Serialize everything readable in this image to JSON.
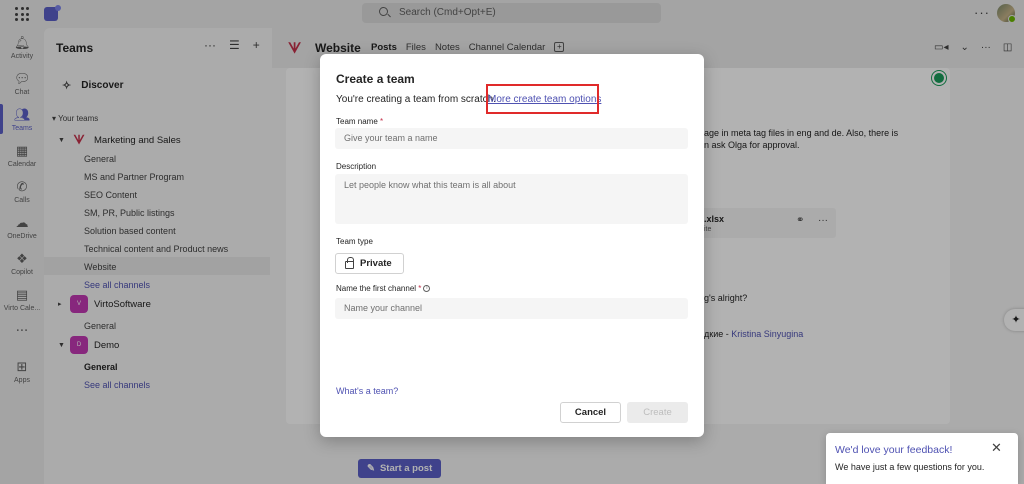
{
  "topbar": {
    "search_placeholder": "Search (Cmd+Opt+E)",
    "more": "···"
  },
  "rail": {
    "items": [
      {
        "label": "Activity",
        "icon": "bell-icon"
      },
      {
        "label": "Chat",
        "icon": "chat-icon"
      },
      {
        "label": "Teams",
        "icon": "teams-icon",
        "active": true
      },
      {
        "label": "Calendar",
        "icon": "calendar-icon"
      },
      {
        "label": "Calls",
        "icon": "phone-icon"
      },
      {
        "label": "OneDrive",
        "icon": "cloud-icon"
      },
      {
        "label": "Copilot",
        "icon": "copilot-icon"
      },
      {
        "label": "Virto Cale...",
        "icon": "app-grid-icon"
      },
      {
        "label": "",
        "icon": "more-icon"
      },
      {
        "label": "Apps",
        "icon": "add-app-icon"
      }
    ]
  },
  "panel": {
    "title": "Teams",
    "discover": "Discover",
    "your_teams": "Your teams",
    "teams": [
      {
        "name": "Marketing and Sales",
        "channels": [
          "General",
          "MS and Partner Program",
          "SEO Content",
          "SM, PR, Public listings",
          "Solution based content",
          "Technical content and Product news",
          "Website",
          "See all channels"
        ]
      },
      {
        "name": "VirtoSoftware",
        "avatar": "V",
        "channels": [
          "General"
        ]
      },
      {
        "name": "Demo",
        "avatar": "D",
        "channels": [
          "General",
          "See all channels"
        ]
      }
    ]
  },
  "main": {
    "title": "Website",
    "tabs": [
      "Posts",
      "Files",
      "Notes",
      "Channel Calendar"
    ],
    "bg_line1": "age in meta tag files in eng and de. Also, there is",
    "bg_line2": "n ask Olga for approval.",
    "bg_file": ".xlsx",
    "bg_file_sub": "ite",
    "bg_line3": "g's alright?",
    "bg_line4_prefix": "дкие - ",
    "bg_line4_name": "Kristina Sinyugina",
    "start_post": "Start a post"
  },
  "dialog": {
    "title": "Create a team",
    "subtitle": "You're creating a team from scratch.",
    "more_options_link": "More create team options",
    "team_name_label": "Team name",
    "team_name_placeholder": "Give your team a name",
    "description_label": "Description",
    "description_placeholder": "Let people know what this team is all about",
    "team_type_label": "Team type",
    "team_type_value": "Private",
    "channel_label": "Name the first channel",
    "channel_placeholder": "Name your channel",
    "whats_link": "What's a team?",
    "cancel": "Cancel",
    "create": "Create",
    "required_mark": "*"
  },
  "toast": {
    "title": "We'd love your feedback!",
    "body": "We have just a few questions for you."
  }
}
